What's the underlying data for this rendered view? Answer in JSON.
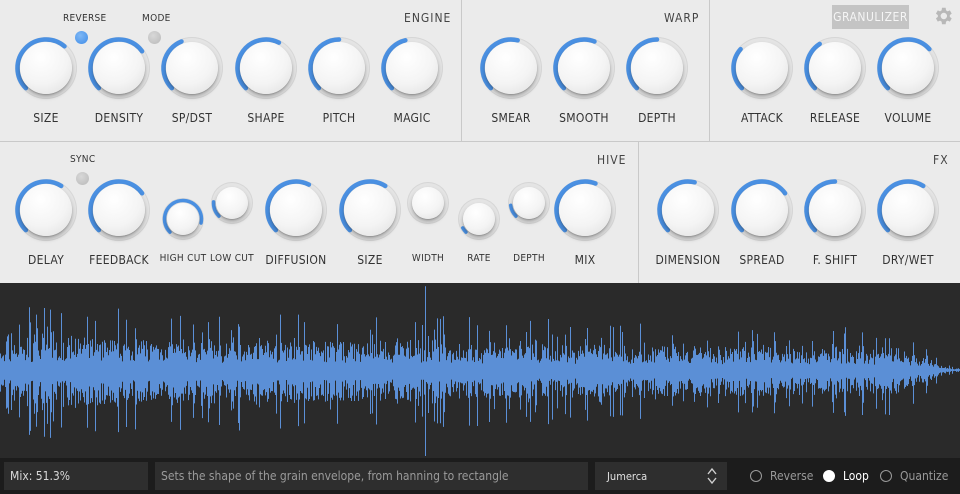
{
  "colors": {
    "accent": "#4a90e2",
    "panel_bg": "#ebebeb",
    "wave": "#5b8fd6",
    "wave_bg": "#2a2a2a",
    "status_bg": "#1c1c1c"
  },
  "engine": {
    "title": "ENGINE",
    "reverse_label": "REVERSE",
    "mode_label": "MODE",
    "reverse_on": true,
    "mode_on": false,
    "knobs": [
      {
        "name": "size-knob",
        "label": "SIZE",
        "value": 0.65
      },
      {
        "name": "density-knob",
        "label": "DENSITY",
        "value": 0.7
      },
      {
        "name": "spdst-knob",
        "label": "SP/DST",
        "value": 0.42
      },
      {
        "name": "shape-knob",
        "label": "SHAPE",
        "value": 0.6
      },
      {
        "name": "pitch-knob",
        "label": "PITCH",
        "value": 0.5
      },
      {
        "name": "magic-knob",
        "label": "MAGIC",
        "value": 0.45
      }
    ]
  },
  "warp": {
    "title": "WARP",
    "knobs": [
      {
        "name": "smear-knob",
        "label": "SMEAR",
        "value": 0.55
      },
      {
        "name": "smooth-knob",
        "label": "SMOOTH",
        "value": 0.58
      },
      {
        "name": "warp-depth-knob",
        "label": "DEPTH",
        "value": 0.5
      }
    ]
  },
  "granulizer": {
    "button_label": "GRANULIZER",
    "knobs": [
      {
        "name": "attack-knob",
        "label": "ATTACK",
        "value": 0.32
      },
      {
        "name": "release-knob",
        "label": "RELEASE",
        "value": 0.38
      },
      {
        "name": "volume-knob",
        "label": "VOLUME",
        "value": 0.68
      }
    ]
  },
  "hive": {
    "title": "HIVE",
    "sync_label": "SYNC",
    "sync_on": false,
    "knobs": [
      {
        "name": "delay-knob",
        "label": "DELAY",
        "value": 0.62
      },
      {
        "name": "feedback-knob",
        "label": "FEEDBACK",
        "value": 0.7
      },
      {
        "name": "high-cut-knob",
        "label": "HIGH CUT",
        "value": 0.88
      },
      {
        "name": "low-cut-knob",
        "label": "LOW CUT",
        "value": 0.18
      },
      {
        "name": "diffusion-knob",
        "label": "DIFFUSION",
        "value": 0.6
      },
      {
        "name": "hive-size-knob",
        "label": "SIZE",
        "value": 0.62
      },
      {
        "name": "width-knob",
        "label": "WIDTH",
        "value": 0.0
      },
      {
        "name": "rate-knob",
        "label": "RATE",
        "value": 0.06
      },
      {
        "name": "hive-depth-knob",
        "label": "DEPTH",
        "value": 0.14
      },
      {
        "name": "mix-knob",
        "label": "MIX",
        "value": 0.58
      }
    ]
  },
  "fx": {
    "title": "FX",
    "knobs": [
      {
        "name": "dimension-knob",
        "label": "DIMENSION",
        "value": 0.55
      },
      {
        "name": "spread-knob",
        "label": "SPREAD",
        "value": 0.7
      },
      {
        "name": "f-shift-knob",
        "label": "F. SHIFT",
        "value": 0.5
      },
      {
        "name": "dry-wet-knob",
        "label": "DRY/WET",
        "value": 0.62
      }
    ]
  },
  "status": {
    "mix_readout": "Mix: 51.3%",
    "help_text": "Sets the shape of the grain envelope, from hanning to rectangle",
    "preset": "Jumerca",
    "options": [
      {
        "label": "Reverse",
        "selected": false
      },
      {
        "label": "Loop",
        "selected": true
      },
      {
        "label": "Quantize",
        "selected": false
      }
    ]
  }
}
